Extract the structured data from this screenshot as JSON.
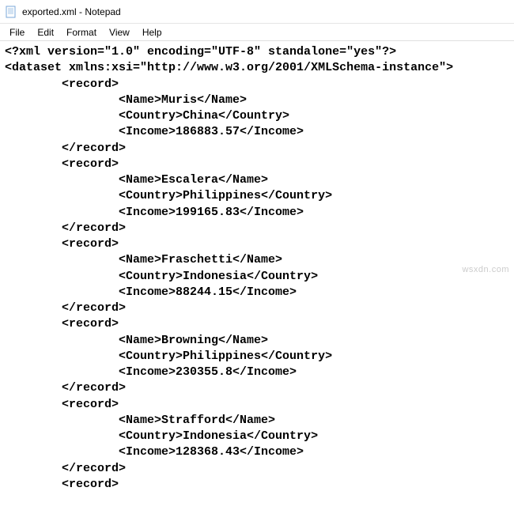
{
  "window": {
    "title": "exported.xml - Notepad"
  },
  "menubar": {
    "file": "File",
    "edit": "Edit",
    "format": "Format",
    "view": "View",
    "help": "Help"
  },
  "xml": {
    "declaration": "<?xml version=\"1.0\" encoding=\"UTF-8\" standalone=\"yes\"?>",
    "root_open": "<dataset xmlns:xsi=\"http://www.w3.org/2001/XMLSchema-instance\">",
    "record_open": "<record>",
    "record_close": "</record>",
    "records": [
      {
        "name": "Muris",
        "country": "China",
        "income": "186883.57"
      },
      {
        "name": "Escalera",
        "country": "Philippines",
        "income": "199165.83"
      },
      {
        "name": "Fraschetti",
        "country": "Indonesia",
        "income": "88244.15"
      },
      {
        "name": "Browning",
        "country": "Philippines",
        "income": "230355.8"
      },
      {
        "name": "Strafford",
        "country": "Indonesia",
        "income": "128368.43"
      }
    ],
    "indent": {
      "record": "        ",
      "field": "                "
    },
    "tags": {
      "name_open": "<Name>",
      "name_close": "</Name>",
      "country_open": "<Country>",
      "country_close": "</Country>",
      "income_open": "<Income>",
      "income_close": "</Income>"
    }
  },
  "watermark": "wsxdn.com"
}
